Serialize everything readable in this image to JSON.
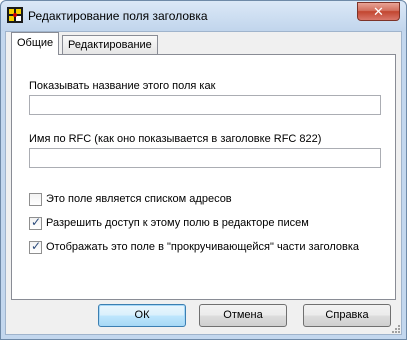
{
  "window": {
    "title": "Редактирование поля заголовка",
    "close_glyph": "✕",
    "icon": "app-icon"
  },
  "tabs": [
    {
      "label": "Общие",
      "active": true
    },
    {
      "label": "Редактирование",
      "active": false
    }
  ],
  "form": {
    "display_name_label": "Показывать название этого поля как",
    "display_name_value": "",
    "rfc_name_label": "Имя по RFC (как оно показывается в заголовке RFC 822)",
    "rfc_name_value": ""
  },
  "options": [
    {
      "label": "Это поле является списком адресов",
      "checked": false
    },
    {
      "label": "Разрешить доступ к этому полю в редакторе писем",
      "checked": true
    },
    {
      "label": "Отображать это поле в \"прокручивающейся\" части заголовка",
      "checked": true
    }
  ],
  "buttons": {
    "ok": "ОК",
    "cancel": "Отмена",
    "help": "Справка"
  },
  "colors": {
    "accent": "#3c7fb1",
    "close": "#c2452f"
  }
}
